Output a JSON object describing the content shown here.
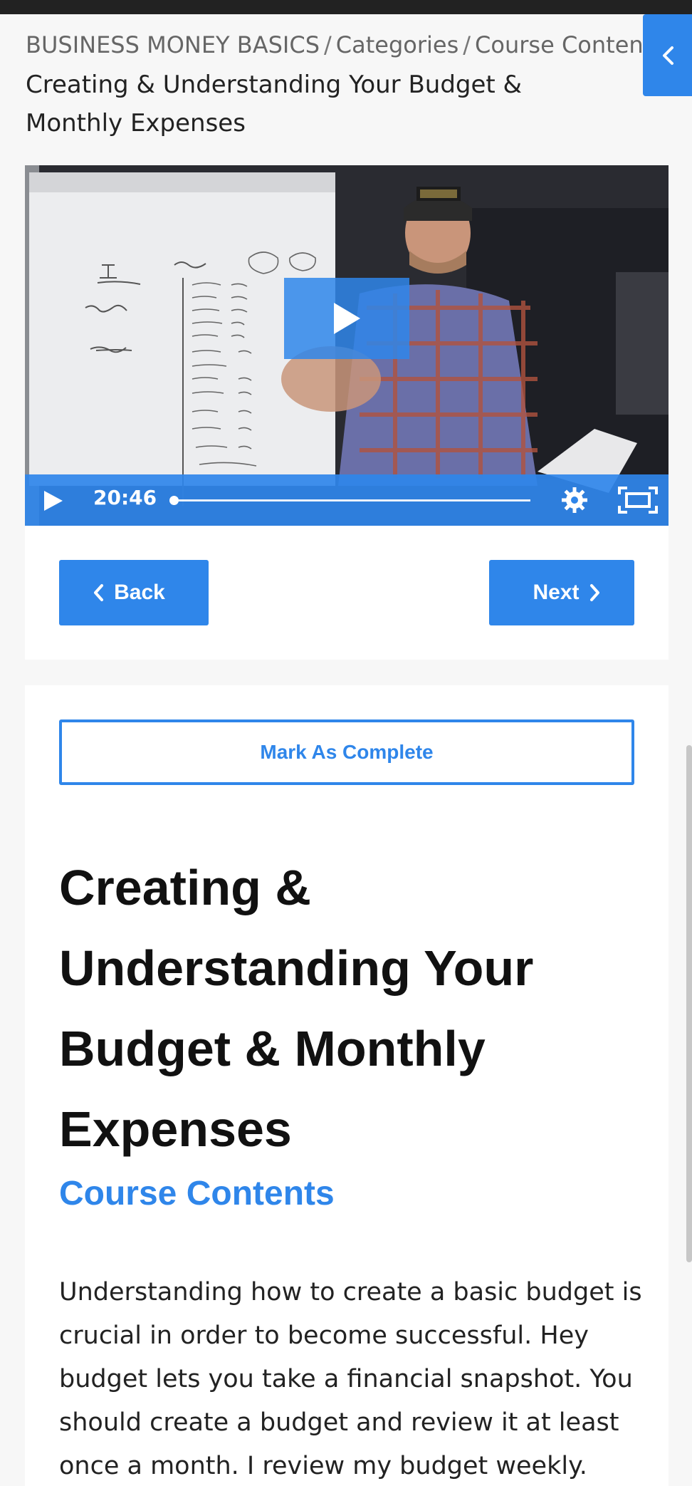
{
  "breadcrumb": {
    "items": [
      "BUSINESS MONEY BASICS",
      "Categories",
      "Course Contents"
    ],
    "separator": "/",
    "current": "Creating & Understanding Your Budget & Monthly Expenses"
  },
  "sidebar_toggle": {
    "icon": "chevron-left-icon"
  },
  "video": {
    "time": "20:46",
    "progress": 0.0,
    "icons": [
      "play-icon",
      "gear-icon",
      "fullscreen-icon"
    ]
  },
  "navigation": {
    "back_label": "Back",
    "next_label": "Next"
  },
  "lesson": {
    "mark_complete_label": "Mark As Complete",
    "title": "Creating & Understanding Your Budget & Monthly Expenses",
    "subtitle": "Course Contents",
    "body": "Understanding how to create a basic budget is crucial in order to become successful. Hey budget lets you take a financial snapshot. You should create a budget and review it at least once a month.  I review my budget weekly."
  },
  "colors": {
    "accent": "#2f86ea",
    "background": "#f7f7f7",
    "card": "#ffffff",
    "text": "#222222"
  }
}
